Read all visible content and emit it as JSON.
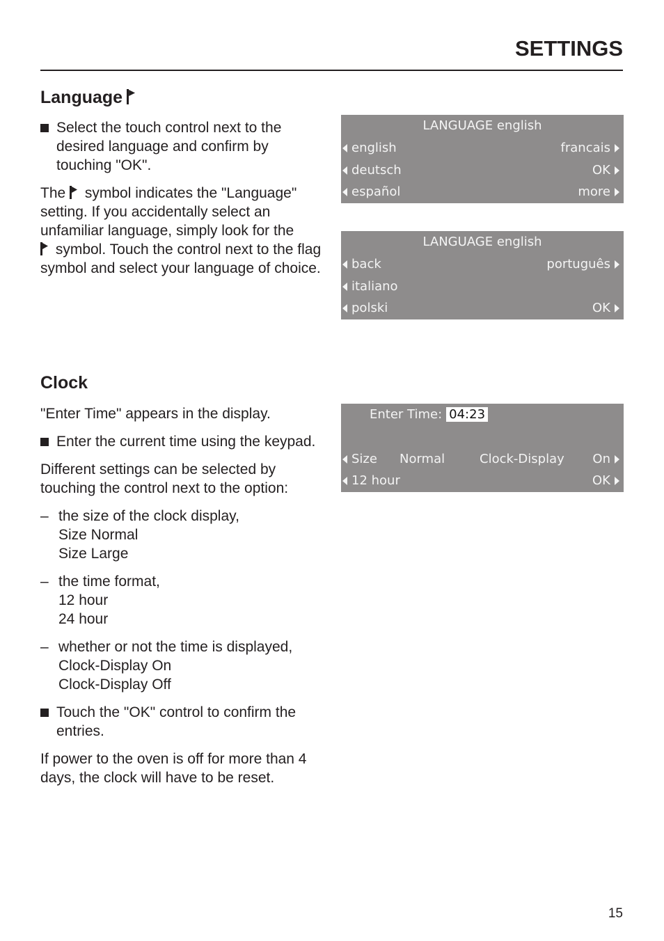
{
  "header": {
    "title": "SETTINGS"
  },
  "language": {
    "heading": "Language",
    "heading_icon": "flag-icon",
    "bullet1": "Select the touch control next to the desired language and confirm by touching \"OK\".",
    "para_parts": {
      "before": "The ",
      "after1": " symbol indicates the \"Language\" setting. If you accidentally select an unfamiliar language, simply look for the",
      "after2": " symbol. Touch the control next to the flag symbol and select your language of choice."
    },
    "display1": {
      "title": "LANGUAGE english",
      "rows": [
        {
          "left": "english",
          "right": "francais"
        },
        {
          "left": "deutsch",
          "right": "OK"
        },
        {
          "left": "español",
          "right": "more"
        }
      ]
    },
    "display2": {
      "title": "LANGUAGE english",
      "rows": [
        {
          "left": "back",
          "right": "português"
        },
        {
          "left": "italiano",
          "right": ""
        },
        {
          "left": "polski",
          "right": "OK"
        }
      ]
    }
  },
  "clock": {
    "heading": "Clock",
    "intro": " \"Enter Time\" appears in the display.",
    "bullet1": "Enter the current time using the keypad.",
    "para1": "Different settings can be selected by touching the control next to the option:",
    "options": [
      {
        "text": "the size of the clock display,",
        "values": [
          "Size Normal",
          "Size Large"
        ]
      },
      {
        "text": "the time format,",
        "values": [
          "12 hour",
          "24 hour"
        ]
      },
      {
        "text": "whether or not the time is displayed,",
        "values": [
          "Clock-Display On",
          "Clock-Display Off"
        ]
      }
    ],
    "bullet2": "Touch the \"OK\" control to confirm the entries.",
    "para2": "If power to the oven is off for more than 4 days, the clock will have to be reset.",
    "display": {
      "enter_label": "Enter Time:",
      "time_value": "04:23",
      "row1": {
        "left_label": "Size",
        "left_value": "Normal",
        "right_label": "Clock-Display",
        "right_value": "On"
      },
      "row2": {
        "left": "12 hour",
        "right": "OK"
      }
    }
  },
  "footer": {
    "page_number": "15"
  },
  "colors": {
    "display_bg": "#8e8c8c",
    "display_text": "#f4f4f4",
    "text": "#231f20"
  }
}
